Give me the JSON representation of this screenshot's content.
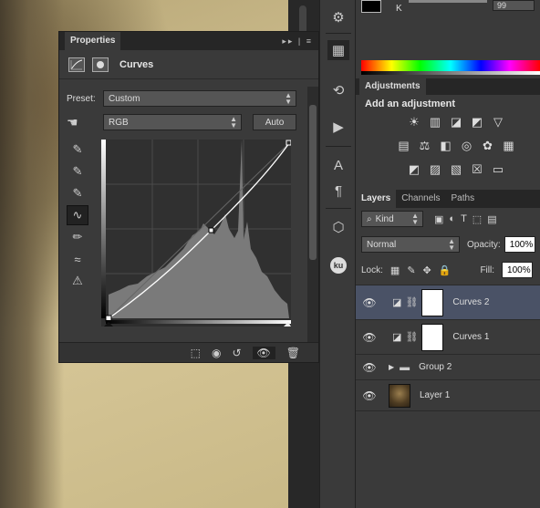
{
  "properties": {
    "tab_label": "Properties",
    "panel_controls": "▸▸ | ≡",
    "title": "Curves",
    "preset_label": "Preset:",
    "preset_value": "Custom",
    "channel_value": "RGB",
    "auto_label": "Auto"
  },
  "color": {
    "k_label": "K",
    "k_value": "99"
  },
  "adjustments": {
    "tab_label": "Adjustments",
    "heading": "Add an adjustment"
  },
  "layers": {
    "tabs": [
      "Layers",
      "Channels",
      "Paths"
    ],
    "filter_kind": "Kind",
    "blend_mode": "Normal",
    "opacity_label": "Opacity:",
    "opacity_value": "100%",
    "lock_label": "Lock:",
    "fill_label": "Fill:",
    "fill_value": "100%",
    "items": [
      {
        "name": "Curves 2"
      },
      {
        "name": "Curves 1"
      },
      {
        "name": "Group 2"
      },
      {
        "name": "Layer 1"
      }
    ]
  },
  "dock": {
    "ku_label": "ku"
  },
  "colors": {
    "selected_layer": "#4a5266",
    "panel_bg": "#3a3a3a"
  }
}
